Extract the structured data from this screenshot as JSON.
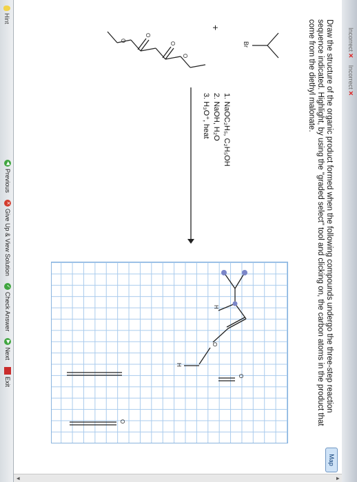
{
  "tabs": {
    "items": [
      "Incorrect",
      "Incorrect"
    ],
    "x_mark": "✕"
  },
  "question": {
    "text": "Draw the structure of the organic product formed when the following compounds undergo the three-step reaction sequence indicated. Highlight, by using the \"graded select\" tool and clicking on, the carbon atoms in the product that come from the diethyl malonate."
  },
  "map_button": {
    "label": "Map"
  },
  "reactants": {
    "halide_label": "Br",
    "plus": "+",
    "o_labels": [
      "O",
      "O",
      "O",
      "O"
    ]
  },
  "conditions": {
    "step1": "1. NaOC₂H₅, C₂H₅OH",
    "step2": "2. NaOH, H₂O",
    "step3": "3. H₃O⁺, heat"
  },
  "product": {
    "h_left": "H",
    "o_label": "O",
    "h_right": "H",
    "o_bottom": "O",
    "o_right": "O"
  },
  "footer": {
    "hint": "Hint",
    "previous": "Previous",
    "give_up": "Give Up & View Solution",
    "check_answer": "Check Answer",
    "next": "Next",
    "exit": "Exit"
  },
  "colors": {
    "grid_line": "#a9cbed",
    "highlight": "#7b86c8",
    "green": "#3fa53f",
    "red": "#d33b2c"
  },
  "icons": [
    "bulb-icon",
    "previous-icon",
    "give-up-icon",
    "check-answer-icon",
    "next-icon",
    "exit-icon",
    "scroll-up-icon",
    "scroll-down-icon"
  ]
}
